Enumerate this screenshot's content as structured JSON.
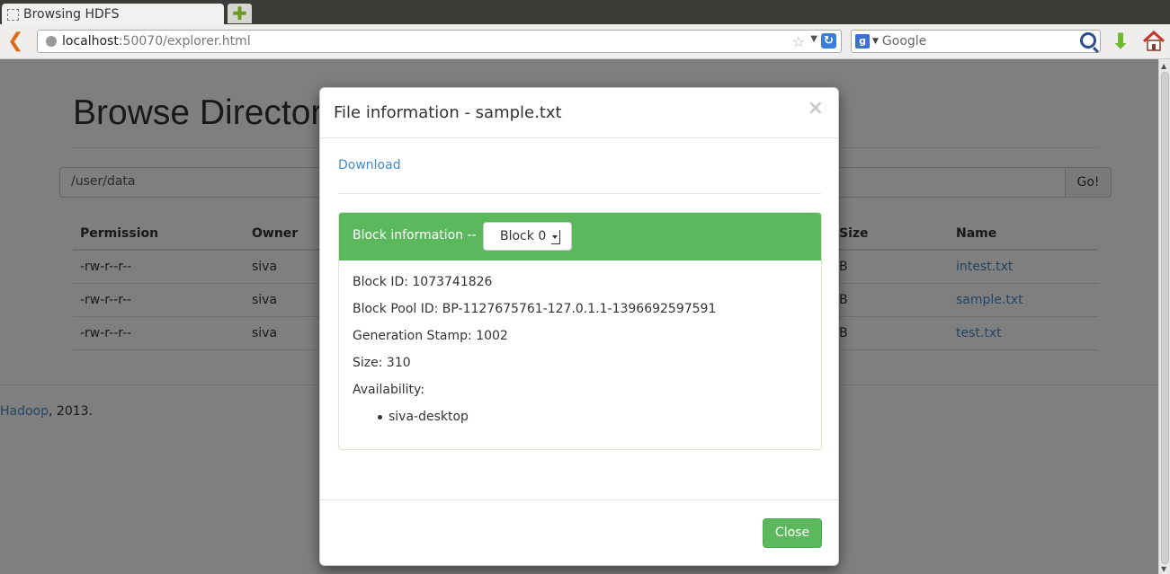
{
  "browser": {
    "tab_title": "Browsing HDFS",
    "new_tab_symbol": "✚",
    "url_host": "localhost",
    "url_rest": ":50070/explorer.html",
    "search_engine_letter": "g",
    "search_placeholder": "Google"
  },
  "page": {
    "title": "Browse Directory",
    "path_value": "/user/data",
    "go_label": "Go!",
    "columns": [
      "Permission",
      "Owner",
      "Size",
      "Name"
    ],
    "rows": [
      {
        "permission": "-rw-r--r--",
        "owner": "siva",
        "size": "B",
        "name": "intest.txt"
      },
      {
        "permission": "-rw-r--r--",
        "owner": "siva",
        "size": "B",
        "name": "sample.txt"
      },
      {
        "permission": "-rw-r--r--",
        "owner": "siva",
        "size": "B",
        "name": "test.txt"
      }
    ],
    "footer_link": "Hadoop",
    "footer_text": ", 2013."
  },
  "modal": {
    "title": "File information - sample.txt",
    "close_symbol": "×",
    "download_label": "Download",
    "panel_label": "Block information --",
    "selected_block": "Block 0",
    "block_id": "Block ID: 1073741826",
    "block_pool_id": "Block Pool ID: BP-1127675761-127.0.1.1-1396692597591",
    "generation_stamp": "Generation Stamp: 1002",
    "size": "Size: 310",
    "availability_label": "Availability:",
    "availability_hosts": [
      "siva-desktop"
    ],
    "close_label": "Close"
  },
  "colors": {
    "primary_link": "#428bca",
    "success": "#5cb85c",
    "backdrop": "rgba(0,0,0,0.5)"
  },
  "icons": [
    "back-arrow-icon",
    "page-favicon-icon",
    "new-tab-icon",
    "globe-icon",
    "bookmark-star-icon",
    "reload-icon",
    "google-icon",
    "search-icon",
    "download-arrow-icon",
    "home-icon",
    "close-icon",
    "select-caret-icon",
    "bullet-icon"
  ]
}
